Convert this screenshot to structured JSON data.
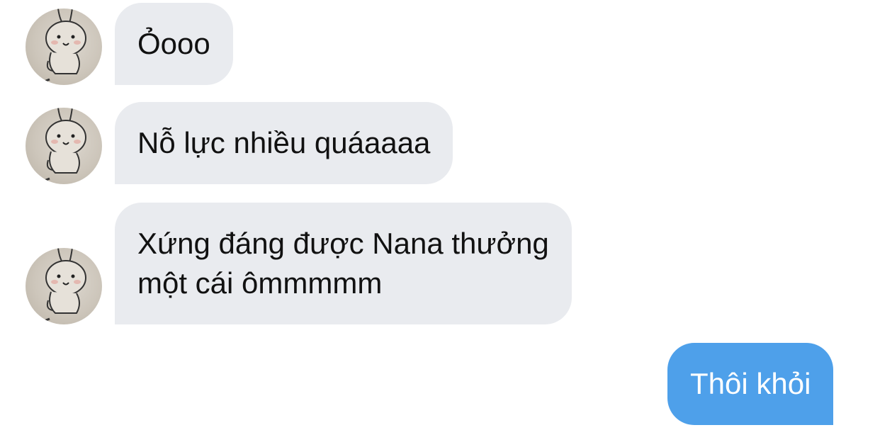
{
  "conversation": {
    "messages": [
      {
        "direction": "incoming",
        "lines": [
          "Ỏooo"
        ]
      },
      {
        "direction": "incoming",
        "lines": [
          "Nỗ lực nhiều quáaaaa"
        ]
      },
      {
        "direction": "incoming",
        "lines": [
          "Xứng đáng được Nana thưởng",
          "một cái ômmmmm"
        ]
      },
      {
        "direction": "outgoing",
        "lines": [
          "Thôi khỏi"
        ]
      }
    ]
  },
  "colors": {
    "incoming_bubble": "#e9ebef",
    "outgoing_bubble": "#4ea0ea",
    "incoming_text": "#111111",
    "outgoing_text": "#ffffff"
  },
  "icons": {
    "avatar": "bunny-sticker-avatar-icon"
  }
}
